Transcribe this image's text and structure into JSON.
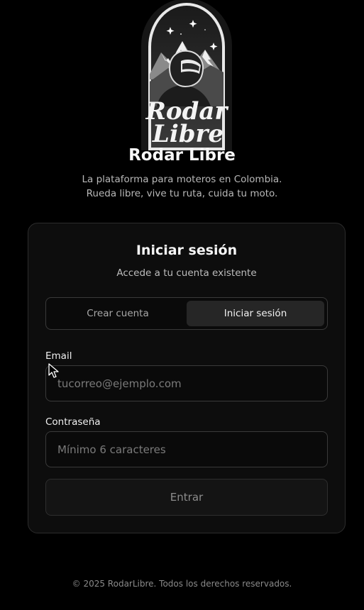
{
  "brand": {
    "logo_line1": "Rodar",
    "logo_line2": "Libre",
    "title": "Rodar Libre",
    "tagline_line1": "La plataforma para moteros en Colombia.",
    "tagline_line2": "Rueda libre, vive tu ruta, cuida tu moto."
  },
  "card": {
    "title": "Iniciar sesión",
    "subtitle": "Accede a tu cuenta existente",
    "tabs": [
      {
        "label": "Crear cuenta",
        "active": false
      },
      {
        "label": "Iniciar sesión",
        "active": true
      }
    ],
    "email": {
      "label": "Email",
      "placeholder": "tucorreo@ejemplo.com",
      "value": ""
    },
    "password": {
      "label": "Contraseña",
      "placeholder": "Mínimo 6 caracteres",
      "value": ""
    },
    "submit_label": "Entrar"
  },
  "footer": {
    "text": "© 2025 RodarLibre. Todos los derechos reservados."
  },
  "colors": {
    "background": "#000000",
    "card": "#0d0d0d",
    "border": "#2c2c2c",
    "active_tab": "#262626"
  }
}
